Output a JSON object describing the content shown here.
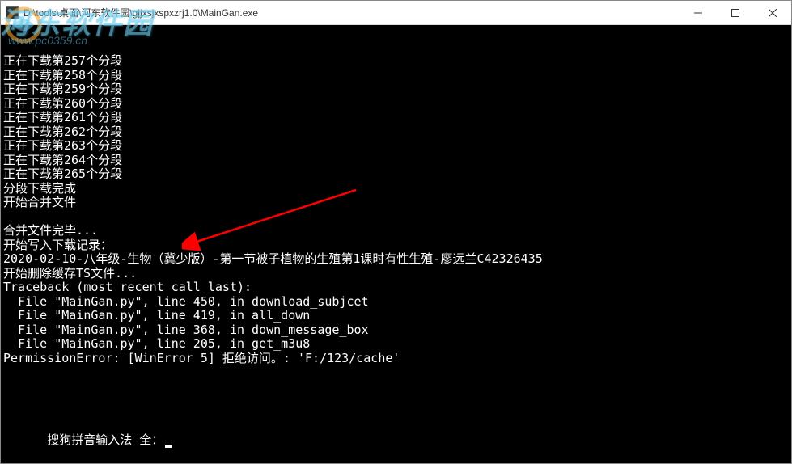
{
  "window": {
    "title": "D:\\tools\\桌面\\河东软件园\\gjjxsjxspxzrj1.0\\MainGan.exe"
  },
  "watermark": {
    "text": "河东软件园",
    "url": "www.pc0359.cn"
  },
  "console": {
    "lines": [
      "正在下载第257个分段",
      "正在下载第258个分段",
      "正在下载第259个分段",
      "正在下载第260个分段",
      "正在下载第261个分段",
      "正在下载第262个分段",
      "正在下载第263个分段",
      "正在下载第264个分段",
      "正在下载第265个分段",
      "分段下载完成",
      "开始合并文件",
      "",
      "合并文件完毕...",
      "开始写入下载记录：",
      "2020-02-10-八年级-生物（冀少版）-第一节被子植物的生殖第1课时有性生殖-廖远兰C42326435",
      "开始删除缓存TS文件...",
      "Traceback (most recent call last):",
      "  File \"MainGan.py\", line 450, in download_subjcet",
      "  File \"MainGan.py\", line 419, in all_down",
      "  File \"MainGan.py\", line 368, in down_message_box",
      "  File \"MainGan.py\", line 205, in get_m3u8",
      "PermissionError: [WinError 5] 拒绝访问。: 'F:/123/cache'"
    ],
    "ime": "搜狗拼音输入法 全："
  }
}
